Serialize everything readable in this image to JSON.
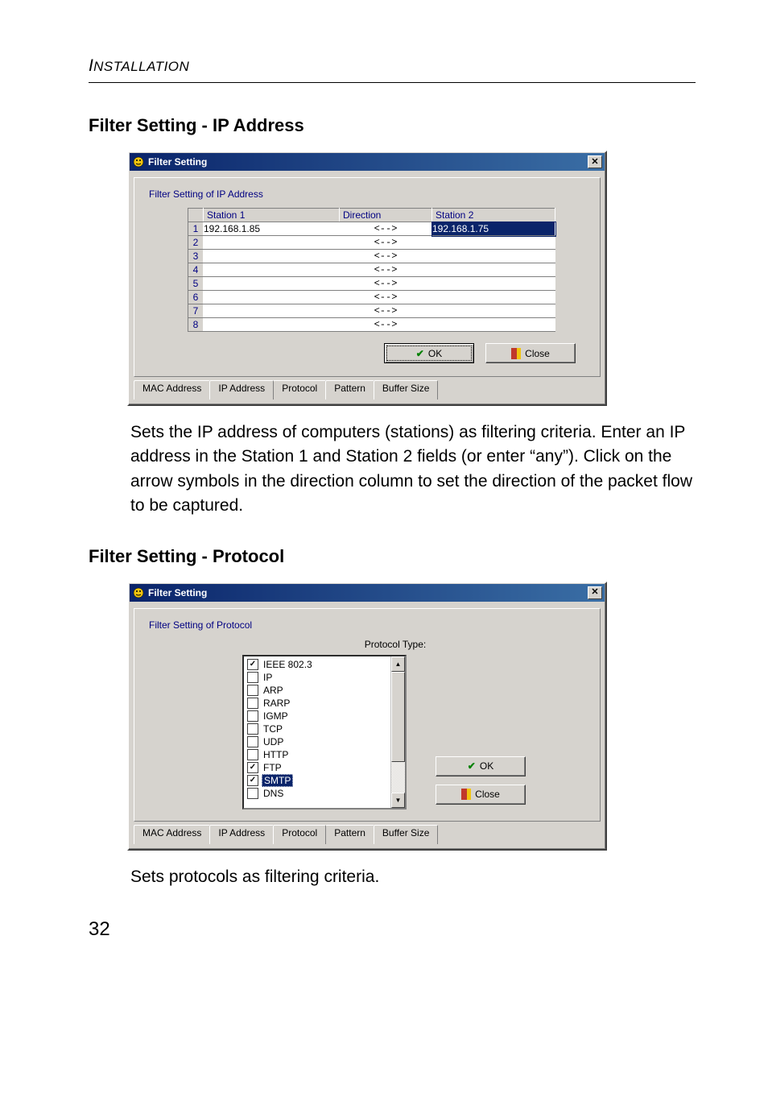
{
  "running_head_italic_first": "I",
  "running_head_caps": "NSTALLATION",
  "section1_title": "Filter Setting - IP Address",
  "section2_title": "Filter Setting - Protocol",
  "body1": "Sets the IP address of computers (stations) as filtering criteria. Enter an IP address in the Station 1 and Station 2 fields (or enter “any”). Click on the arrow symbols in the direction column to set the direction of the packet flow to be captured.",
  "body2": "Sets protocols as filtering criteria.",
  "page_number": "32",
  "dialog": {
    "title": "Filter Setting",
    "close_glyph": "✕",
    "ok_label": "OK",
    "close_label": "Close",
    "tabs": [
      "MAC Address",
      "IP Address",
      "Protocol",
      "Pattern",
      "Buffer Size"
    ]
  },
  "ip_panel": {
    "group_label": "Filter Setting of IP Address",
    "headers": {
      "col1": "Station 1",
      "col2": "Direction",
      "col3": "Station 2"
    },
    "dir_glyph": "<-->",
    "rows": [
      {
        "n": "1",
        "s1": "192.168.1.85",
        "s2": "192.168.1.75",
        "s2_selected": true
      },
      {
        "n": "2",
        "s1": "",
        "s2": ""
      },
      {
        "n": "3",
        "s1": "",
        "s2": ""
      },
      {
        "n": "4",
        "s1": "",
        "s2": ""
      },
      {
        "n": "5",
        "s1": "",
        "s2": ""
      },
      {
        "n": "6",
        "s1": "",
        "s2": ""
      },
      {
        "n": "7",
        "s1": "",
        "s2": ""
      },
      {
        "n": "8",
        "s1": "",
        "s2": ""
      }
    ]
  },
  "proto_panel": {
    "group_label": "Filter Setting of Protocol",
    "type_label": "Protocol Type:",
    "items": [
      {
        "label": "IEEE 802.3",
        "checked": true,
        "selected": false
      },
      {
        "label": "IP",
        "checked": false,
        "selected": false
      },
      {
        "label": "ARP",
        "checked": false,
        "selected": false
      },
      {
        "label": "RARP",
        "checked": false,
        "selected": false
      },
      {
        "label": "IGMP",
        "checked": false,
        "selected": false
      },
      {
        "label": "TCP",
        "checked": false,
        "selected": false
      },
      {
        "label": "UDP",
        "checked": false,
        "selected": false
      },
      {
        "label": "HTTP",
        "checked": false,
        "selected": false
      },
      {
        "label": "FTP",
        "checked": true,
        "selected": false
      },
      {
        "label": "SMTP",
        "checked": true,
        "selected": true
      },
      {
        "label": "DNS",
        "checked": false,
        "selected": false
      }
    ],
    "scroll_up": "▲",
    "scroll_down": "▼"
  }
}
